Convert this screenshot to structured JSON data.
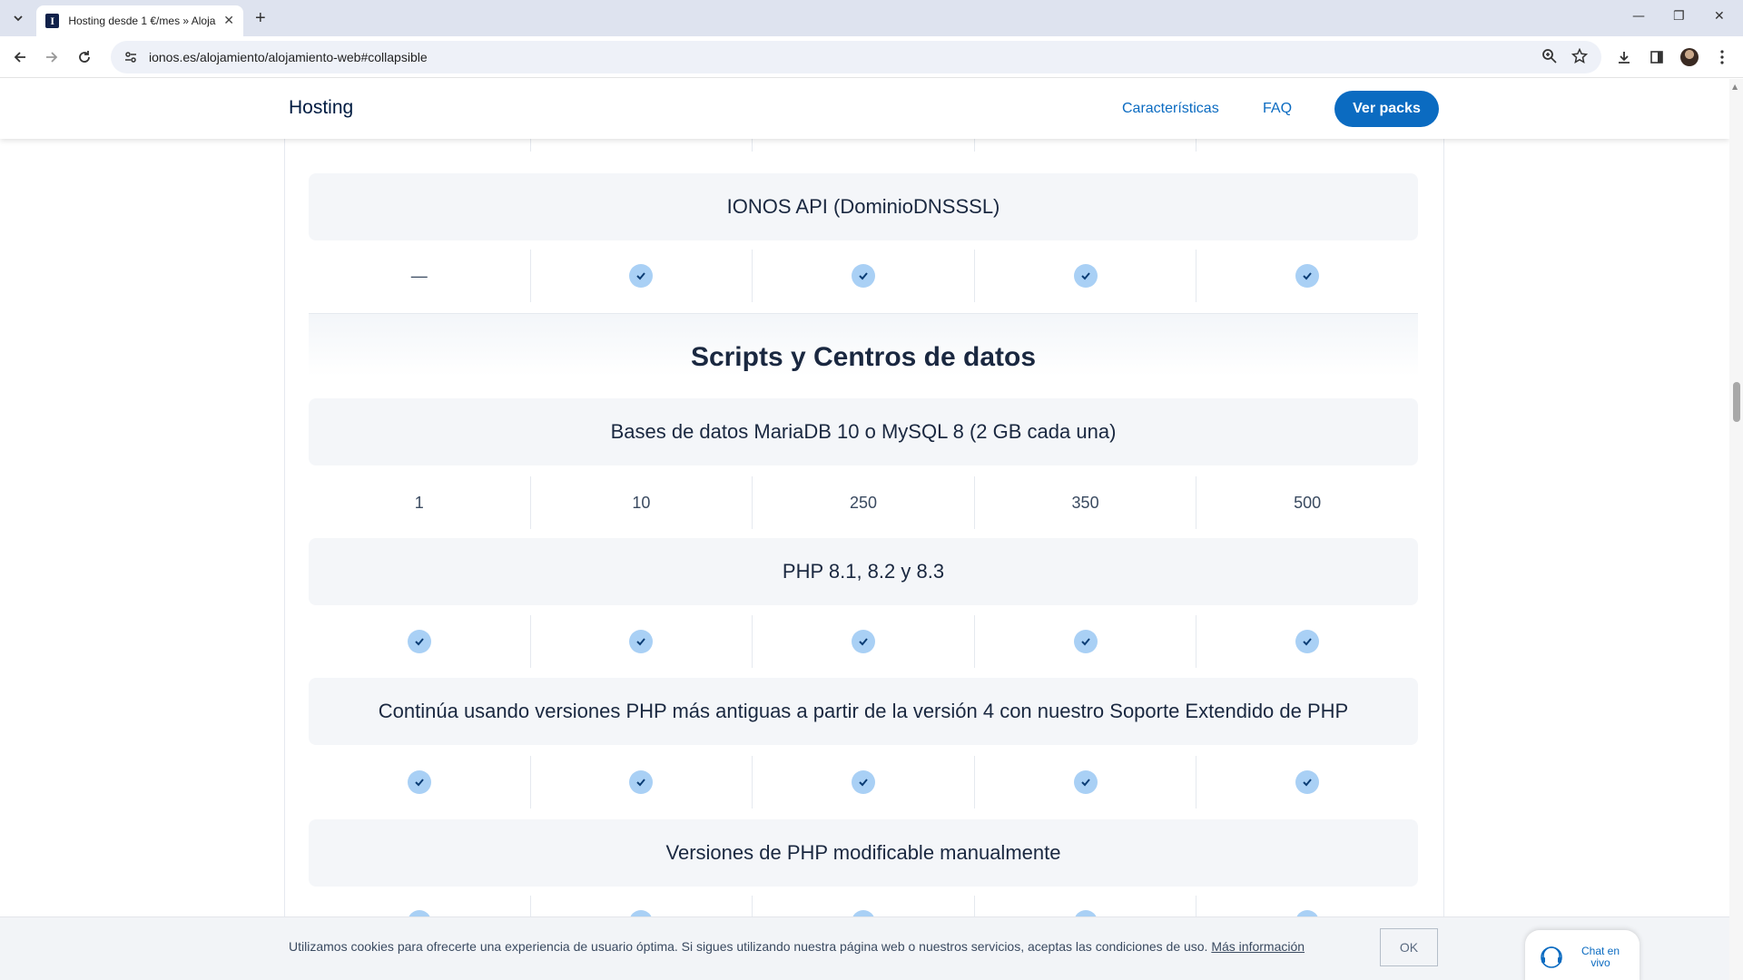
{
  "browser": {
    "tab_title": "Hosting desde 1 €/mes » Aloja",
    "url": "ionos.es/alojamiento/alojamiento-web#collapsible"
  },
  "header": {
    "brand": "Hosting",
    "nav": [
      "Características",
      "FAQ"
    ],
    "cta": "Ver packs"
  },
  "features": {
    "api_title": "IONOS API (DominioDNSSSL)",
    "api_values": [
      "—",
      "check",
      "check",
      "check",
      "check"
    ],
    "section_title": "Scripts y Centros de datos",
    "db_title": "Bases de datos MariaDB 10 o MySQL 8 (2 GB cada una)",
    "db_values": [
      "1",
      "10",
      "250",
      "350",
      "500"
    ],
    "php_title": "PHP 8.1, 8.2 y 8.3",
    "php_values": [
      "check",
      "check",
      "check",
      "check",
      "check"
    ],
    "legacy_title": "Continúa usando versiones PHP más antiguas a partir de la versión 4 con nuestro Soporte Extendido de PHP",
    "legacy_values": [
      "check",
      "check",
      "check",
      "check",
      "check"
    ],
    "manual_title": "Versiones de PHP modificable manualmente"
  },
  "cookie": {
    "text": "Utilizamos cookies para ofrecerte una experiencia de usuario óptima. Si sigues utilizando nuestra página web o nuestros servicios, aceptas las condiciones de uso.",
    "link": "Más información",
    "ok": "OK"
  },
  "chat": {
    "label": "Chat en vivo"
  },
  "colors": {
    "accent": "#0b6bc1",
    "check_fill": "#a9d0f5",
    "feature_bg": "#f4f6f9"
  }
}
